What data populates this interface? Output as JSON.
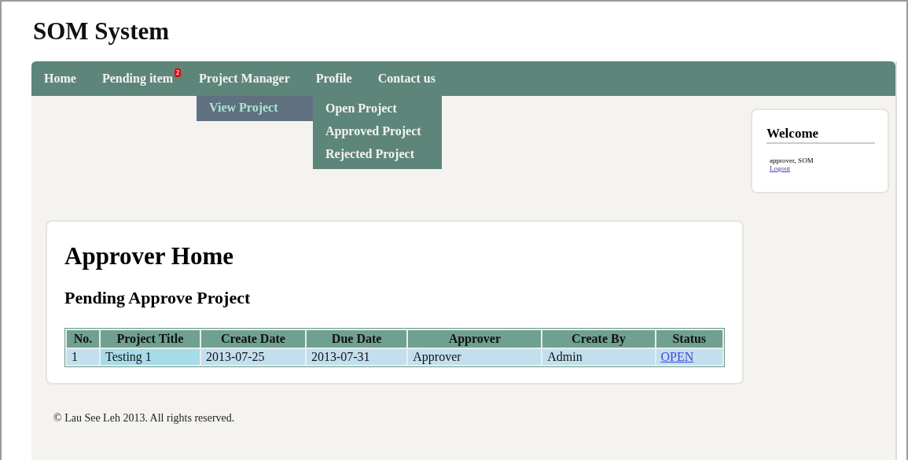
{
  "site_title": "SOM System",
  "nav": [
    {
      "label": "Home"
    },
    {
      "label": "Pending item",
      "badge": "2"
    },
    {
      "label": "Project Manager",
      "submenu": [
        {
          "label": "View Project",
          "selected": true,
          "children": [
            {
              "label": "Open Project"
            },
            {
              "label": "Approved Project"
            },
            {
              "label": "Rejected Project"
            }
          ]
        }
      ]
    },
    {
      "label": "Profile"
    },
    {
      "label": "Contact us"
    }
  ],
  "main": {
    "title": "Approver Home",
    "subtitle": "Pending Approve Project",
    "table": {
      "columns": [
        "No.",
        "Project Title",
        "Create Date",
        "Due Date",
        "Approver",
        "Create By",
        "Status"
      ],
      "rows": [
        {
          "cells": [
            "1",
            "Testing 1",
            "2013-07-25",
            "2013-07-31",
            "Approver",
            "Admin"
          ],
          "status": "OPEN"
        }
      ]
    }
  },
  "sidebar": {
    "title": "Welcome",
    "user": "approver, SOM",
    "logout": "Logout"
  },
  "footer": "© Lau See Leh 2013. All rights reserved."
}
